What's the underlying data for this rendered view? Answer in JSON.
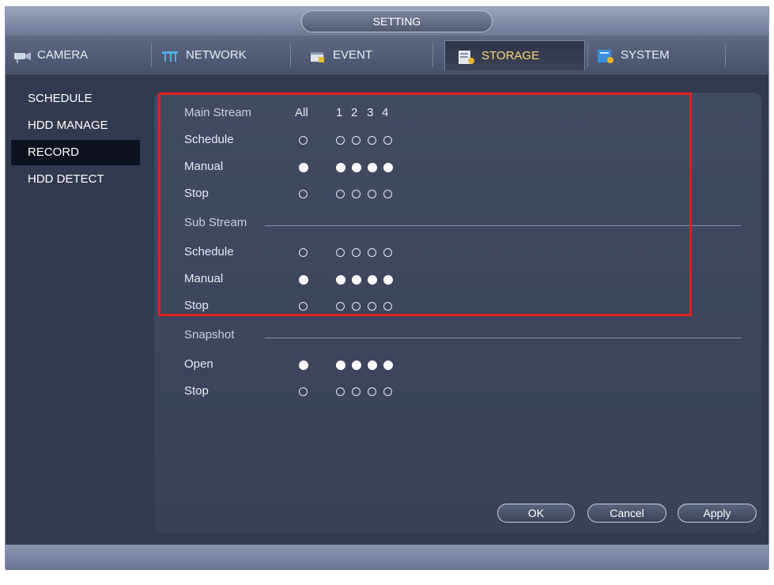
{
  "window": {
    "title": "SETTING"
  },
  "tabs": [
    {
      "label": "CAMERA",
      "icon": "camera-icon"
    },
    {
      "label": "NETWORK",
      "icon": "network-icon"
    },
    {
      "label": "EVENT",
      "icon": "event-icon"
    },
    {
      "label": "STORAGE",
      "icon": "storage-icon",
      "active": true
    },
    {
      "label": "SYSTEM",
      "icon": "system-icon"
    }
  ],
  "menu": [
    {
      "label": "SCHEDULE"
    },
    {
      "label": "HDD MANAGE"
    },
    {
      "label": "RECORD",
      "active": true
    },
    {
      "label": "HDD DETECT"
    }
  ],
  "record": {
    "main_stream_label": "Main Stream",
    "all_label": "All",
    "channels": [
      "1",
      "2",
      "3",
      "4"
    ],
    "main_rows": [
      {
        "label": "Schedule",
        "selected": false
      },
      {
        "label": "Manual",
        "selected": true
      },
      {
        "label": "Stop",
        "selected": false
      }
    ],
    "sub_stream_label": "Sub Stream",
    "sub_rows": [
      {
        "label": "Schedule",
        "selected": false
      },
      {
        "label": "Manual",
        "selected": true
      },
      {
        "label": "Stop",
        "selected": false
      }
    ],
    "snapshot_label": "Snapshot",
    "snapshot_rows": [
      {
        "label": "Open",
        "selected": true
      },
      {
        "label": "Stop",
        "selected": false
      }
    ]
  },
  "buttons": {
    "ok": "OK",
    "cancel": "Cancel",
    "apply": "Apply"
  },
  "colors": {
    "active_tab_text": "#ffd87a",
    "highlight_box": "#e0201e"
  }
}
